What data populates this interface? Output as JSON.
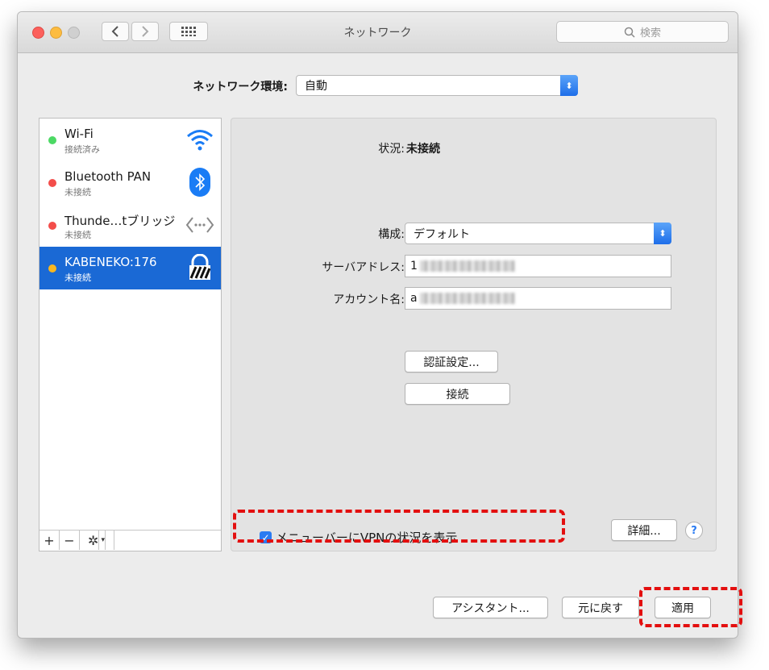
{
  "window": {
    "title": "ネットワーク",
    "search_placeholder": "検索",
    "back_icon": "chevron-left-icon",
    "forward_icon": "chevron-right-icon",
    "grid_icon": "grid-icon"
  },
  "location": {
    "label": "ネットワーク環境:",
    "value": "自動"
  },
  "services": [
    {
      "name": "Wi-Fi",
      "status": "接続済み",
      "dot_color": "#4cd964",
      "icon": "wifi-icon"
    },
    {
      "name": "Bluetooth PAN",
      "status": "未接続",
      "dot_color": "#f34d4a",
      "icon": "bluetooth-icon"
    },
    {
      "name": "Thunde…tブリッジ",
      "status": "未接続",
      "dot_color": "#f34d4a",
      "icon": "thunderbolt-bridge-icon"
    },
    {
      "name": "KABENEKO:176",
      "status": "未接続",
      "dot_color": "#f8b720",
      "icon": "vpn-lock-icon",
      "selected": true
    }
  ],
  "sidebar_tools": {
    "add": "+",
    "remove": "−",
    "gear": "gear-icon"
  },
  "detail": {
    "status_label": "状況:",
    "status_value": "未接続",
    "config_label": "構成:",
    "config_value": "デフォルト",
    "server_label": "サーバアドレス:",
    "server_value": "1",
    "account_label": "アカウント名:",
    "account_value": "a",
    "auth_button": "認証設定...",
    "connect_button": "接続",
    "show_vpn_label": "メニューバーにVPNの状況を表示",
    "show_vpn_checked": true,
    "advanced_button": "詳細...",
    "help": "?"
  },
  "footer": {
    "assistant_button": "アシスタント...",
    "revert_button": "元に戻す",
    "apply_button": "適用"
  },
  "colors": {
    "accent": "#1a69d5",
    "highlight": "#e30f0f"
  }
}
